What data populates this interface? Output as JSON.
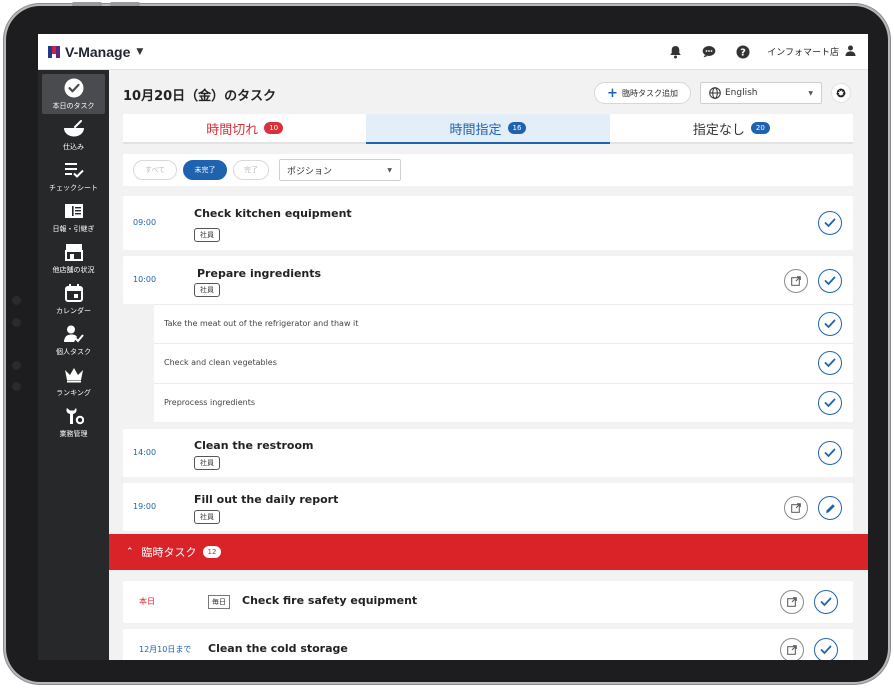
{
  "app": {
    "name": "V-Manage",
    "store": "インフォマート店"
  },
  "icons": {
    "bell": "bell-icon",
    "chat": "chat-icon",
    "help": "help-icon",
    "user": "person-icon",
    "settings": "gear-icon",
    "globe": "globe-icon",
    "check": "check-icon",
    "open": "open-external-icon",
    "edit": "pencil-icon"
  },
  "colors": {
    "accent": "#1e63b0",
    "danger": "#da2229",
    "sidebar": "#27282a"
  },
  "sidebar": {
    "items": [
      {
        "label": "本日のタスク",
        "icon": "check-circle-icon",
        "active": true
      },
      {
        "label": "仕込み",
        "icon": "bowl-icon"
      },
      {
        "label": "チェックシート",
        "icon": "checklist-icon"
      },
      {
        "label": "日報・引継ぎ",
        "icon": "book-icon"
      },
      {
        "label": "他店舗の状況",
        "icon": "store-icon"
      },
      {
        "label": "カレンダー",
        "icon": "calendar-icon"
      },
      {
        "label": "個人タスク",
        "icon": "person-check-icon"
      },
      {
        "label": "ランキング",
        "icon": "crown-icon"
      },
      {
        "label": "業務管理",
        "icon": "tools-icon"
      }
    ]
  },
  "header": {
    "title": "10月20日（金）のタスク",
    "add_button": "臨時タスク追加",
    "language": "English"
  },
  "tabs": [
    {
      "label": "時間切れ",
      "count": "10",
      "style": "red"
    },
    {
      "label": "時間指定",
      "count": "16",
      "style": "active"
    },
    {
      "label": "指定なし",
      "count": "20",
      "style": "normal"
    }
  ],
  "filters": {
    "all": "すべて",
    "incomplete": "未完了",
    "complete": "完了",
    "position_placeholder": "ポジション"
  },
  "tasks": [
    {
      "time": "09:00",
      "title": "Check kitchen equipment",
      "tag": "社員"
    },
    {
      "time": "10:00",
      "title": "Prepare ingredients",
      "tag": "社員",
      "subtasks": [
        "Take the meat out of the refrigerator and thaw it",
        "Check and clean vegetables",
        "Preprocess ingredients"
      ]
    },
    {
      "time": "14:00",
      "title": "Clean the restroom",
      "tag": "社員"
    },
    {
      "time": "19:00",
      "title": "Fill out the daily report",
      "tag": "社員"
    }
  ],
  "adhoc": {
    "label": "臨時タスク",
    "count": "12",
    "items": [
      {
        "due": "本日",
        "freq": "毎日",
        "title": "Check fire safety equipment"
      },
      {
        "due": "12月10日まで",
        "title": "Clean the cold storage"
      }
    ]
  }
}
